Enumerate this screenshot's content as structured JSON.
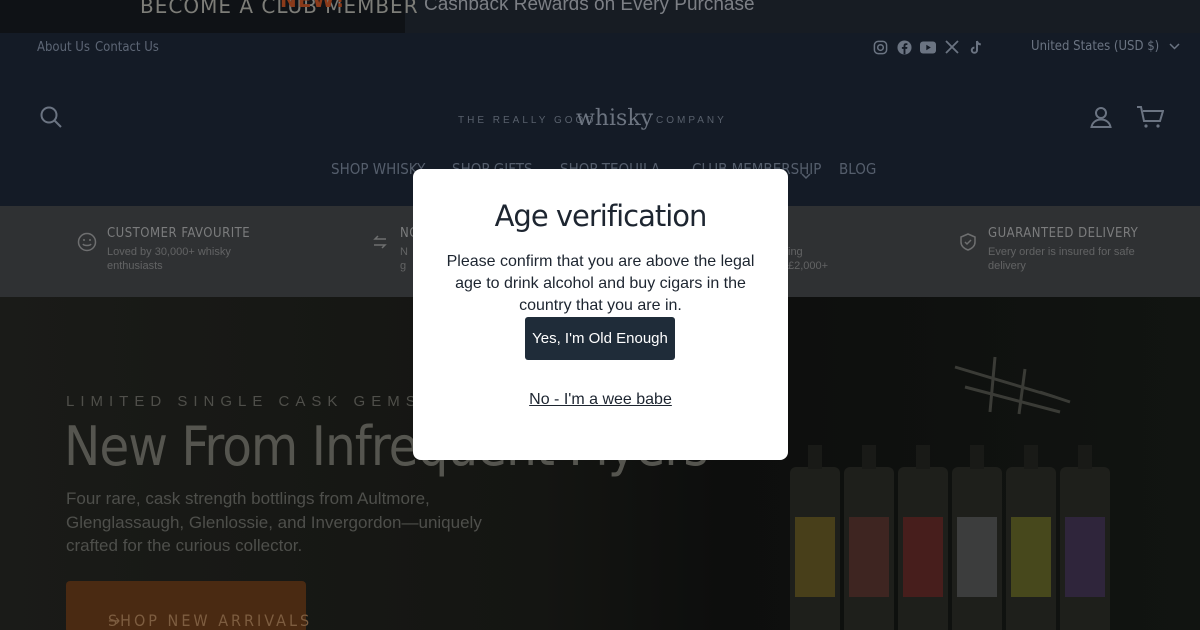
{
  "announcement": {
    "new_label": "NEW!",
    "promo_text": "BECOME A CLUB MEMBER",
    "cashback_text": "Cashback Rewards on Every Purchase"
  },
  "utility_nav": {
    "links": [
      "About Us",
      "Contact Us"
    ],
    "socials": [
      "instagram-icon",
      "facebook-icon",
      "youtube-icon",
      "x-icon",
      "tiktok-icon"
    ],
    "currency": "United States (USD $)"
  },
  "logo": {
    "prefix": "THE REALLY GOOD",
    "brand": "whisky",
    "suffix": "COMPANY"
  },
  "main_nav": {
    "items": [
      "SHOP WHISKY",
      "SHOP GIFTS",
      "SHOP TEQUILA",
      "CLUB MEMBERSHIP",
      "BLOG"
    ]
  },
  "benefits": [
    {
      "icon": "smile-icon",
      "title": "CUSTOMER FAVOURITE",
      "desc": "Loved by 30,000+ whisky enthusiasts"
    },
    {
      "icon": "return-icon",
      "title": "NO",
      "desc": "N g"
    },
    {
      "icon": "shipping-icon",
      "title": "",
      "desc": "ing £2,000+"
    },
    {
      "icon": "shield-check-icon",
      "title": "GUARANTEED DELIVERY",
      "desc": "Every order is insured for safe delivery"
    }
  ],
  "hero": {
    "eyebrow": "LIMITED SINGLE CASK GEMS",
    "headline": "New From Infrequent Flyers",
    "subtext": "Four rare, cask strength bottlings from Aultmore, Glenglassaugh, Glenlossie, and Invergordon—uniquely crafted for the curious collector.",
    "cta": "SHOP NEW ARRIVALS",
    "bottle_label_colors": [
      "#6b5a1a",
      "#5a2a26",
      "#6a1d1d",
      "#55565a",
      "#6a6a1e",
      "#3e2a55"
    ]
  },
  "modal": {
    "title": "Age verification",
    "text": "Please confirm that you are above the legal age to drink alcohol and buy cigars in the country that you are in.",
    "confirm_button": "Yes, I'm Old Enough",
    "deny_link": "No - I'm a wee babe"
  },
  "colors": {
    "modal_button": "#1f2c39",
    "header_bg": "#141b26",
    "cta_bg": "#4a2a12"
  }
}
